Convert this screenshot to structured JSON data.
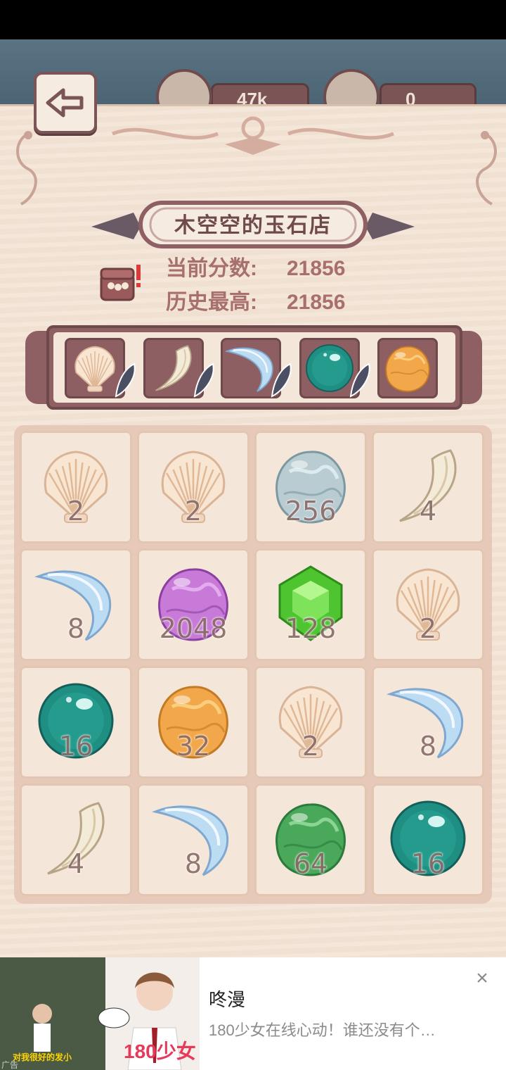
{
  "resources": {
    "feather_count": "47k",
    "jar_count": "0"
  },
  "shop": {
    "title": "木空空的玉石店",
    "current_score_label": "当前分数:",
    "current_score": "21856",
    "best_score_label": "历史最高:",
    "best_score": "21856"
  },
  "sequence": [
    {
      "item": "shell",
      "color": "#f2e0cc"
    },
    {
      "item": "claw",
      "color": "#efe4cf"
    },
    {
      "item": "crescent",
      "color": "#a9d1f2"
    },
    {
      "item": "pearl",
      "color": "#2f9a8e"
    },
    {
      "item": "gem-orange",
      "color": "#f0a443"
    }
  ],
  "board": [
    [
      {
        "item": "shell",
        "value": "2"
      },
      {
        "item": "shell",
        "value": "2"
      },
      {
        "item": "gem-pale",
        "value": "256"
      },
      {
        "item": "claw",
        "value": "4"
      }
    ],
    [
      {
        "item": "crescent",
        "value": "8"
      },
      {
        "item": "gem-purple",
        "value": "2048"
      },
      {
        "item": "emerald",
        "value": "128"
      },
      {
        "item": "shell",
        "value": "2"
      }
    ],
    [
      {
        "item": "pearl",
        "value": "16"
      },
      {
        "item": "gem-orange",
        "value": "32"
      },
      {
        "item": "shell",
        "value": "2"
      },
      {
        "item": "crescent",
        "value": "8"
      }
    ],
    [
      {
        "item": "claw",
        "value": "4"
      },
      {
        "item": "crescent",
        "value": "8"
      },
      {
        "item": "gem-green",
        "value": "64"
      },
      {
        "item": "pearl",
        "value": "16"
      }
    ]
  ],
  "ad": {
    "title": "咚漫",
    "description": "180少女在线心动！谁还没有个…",
    "badge": "180少女",
    "caption": "对我很好的发小",
    "tag": "广告",
    "close_icon": "close-icon"
  }
}
